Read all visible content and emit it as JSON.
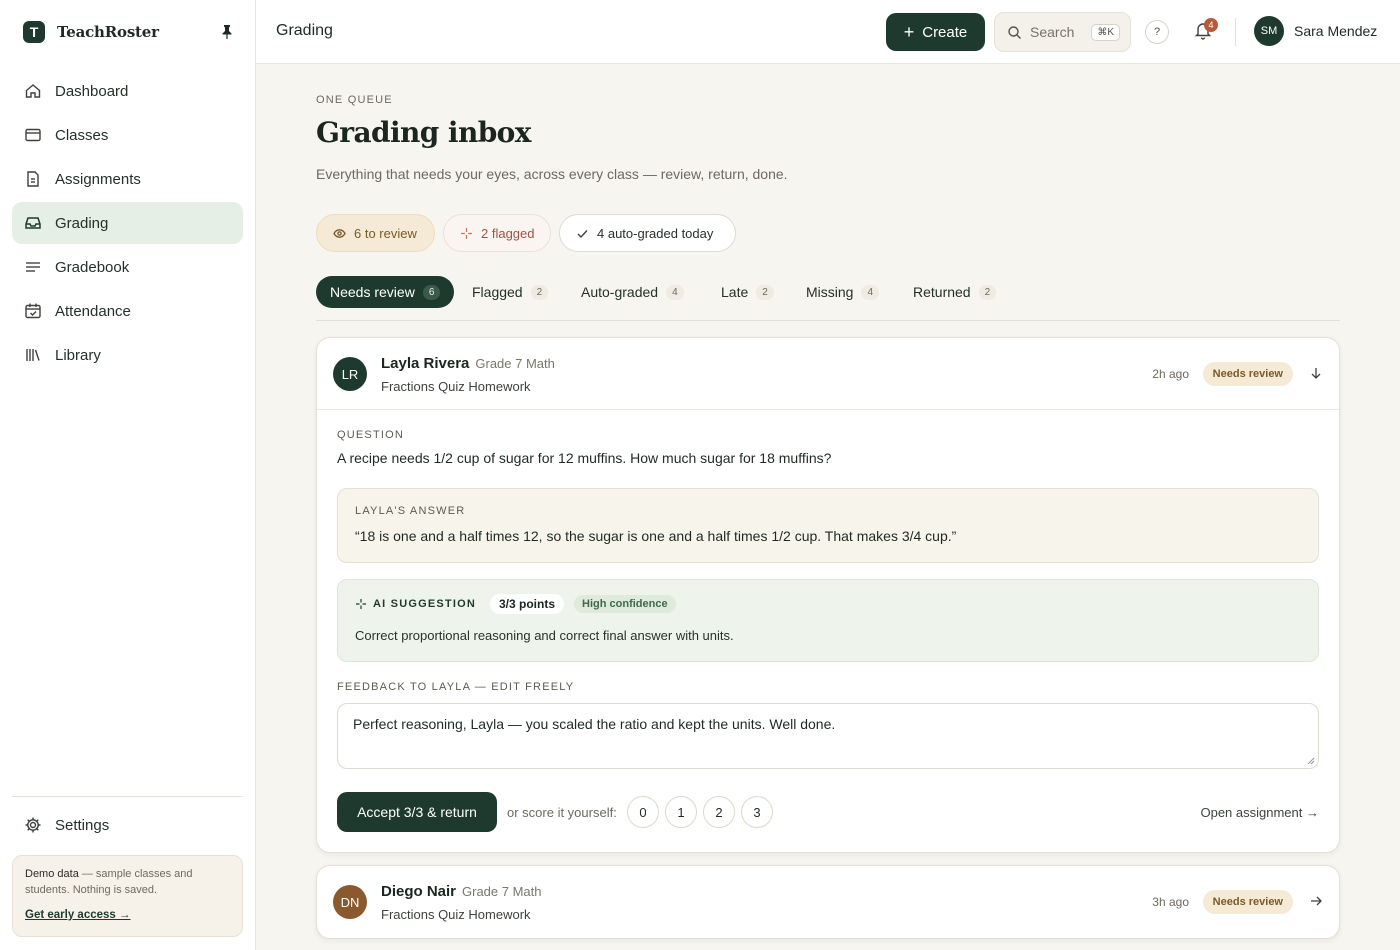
{
  "app": {
    "name": "TeachRoster",
    "logo_letter": "T"
  },
  "sidebar": {
    "items": [
      {
        "label": "Dashboard",
        "icon": "home-icon"
      },
      {
        "label": "Classes",
        "icon": "window-icon"
      },
      {
        "label": "Assignments",
        "icon": "document-icon"
      },
      {
        "label": "Grading",
        "icon": "inbox-icon",
        "active": true
      },
      {
        "label": "Gradebook",
        "icon": "list-icon"
      },
      {
        "label": "Attendance",
        "icon": "calendar-check-icon"
      },
      {
        "label": "Library",
        "icon": "books-icon"
      }
    ],
    "settings_label": "Settings",
    "demo": {
      "title": "Demo data",
      "text": " — sample classes and students. Nothing is saved.",
      "link": "Get early access →"
    }
  },
  "header": {
    "title": "Grading",
    "create_label": "Create",
    "search_placeholder": "Search",
    "search_shortcut": "⌘K",
    "help_label": "?",
    "notifications_count": "4",
    "user_initials": "SM",
    "user_name": "Sara Mendez"
  },
  "main": {
    "eyebrow": "ONE QUEUE",
    "title": "Grading inbox",
    "subtitle": "Everything that needs your eyes, across every class — review, return, done.",
    "summary": {
      "review": "6 to review",
      "flagged": "2 flagged",
      "auto": "4 auto-graded today"
    },
    "tabs": [
      {
        "label": "Needs review",
        "count": "6",
        "active": true
      },
      {
        "label": "Flagged",
        "count": "2"
      },
      {
        "label": "Auto-graded",
        "count": "4"
      },
      {
        "label": "Late",
        "count": "2"
      },
      {
        "label": "Missing",
        "count": "4"
      },
      {
        "label": "Returned",
        "count": "2"
      }
    ]
  },
  "submissions": [
    {
      "initials": "LR",
      "avatar_color": "#1e3a2f",
      "name": "Layla Rivera",
      "class": "Grade 7 Math",
      "assignment": "Fractions Quiz Homework",
      "ago": "2h ago",
      "status": "Needs review",
      "question_label": "QUESTION",
      "question": "A recipe needs 1/2 cup of sugar for 12 muffins. How much sugar for 18 muffins?",
      "answer_label": "LAYLA'S ANSWER",
      "answer": "“18 is one and a half times 12, so the sugar is one and a half times 1/2 cup. That makes 3/4 cup.”",
      "ai_label": "AI SUGGESTION",
      "ai_points": "3/3 points",
      "ai_confidence": "High confidence",
      "ai_text": "Correct proportional reasoning and correct final answer with units.",
      "feedback_label": "FEEDBACK TO LAYLA — EDIT FREELY",
      "feedback": "Perfect reasoning, Layla — you scaled the ratio and kept the units. Well done.",
      "accept_label": "Accept 3/3 & return",
      "score_label": "or score it yourself:",
      "scores": [
        "0",
        "1",
        "2",
        "3"
      ],
      "open_label": "Open assignment →"
    },
    {
      "initials": "DN",
      "avatar_color": "#8a5a2e",
      "name": "Diego Nair",
      "class": "Grade 7 Math",
      "assignment": "Fractions Quiz Homework",
      "ago": "3h ago",
      "status": "Needs review"
    }
  ]
}
